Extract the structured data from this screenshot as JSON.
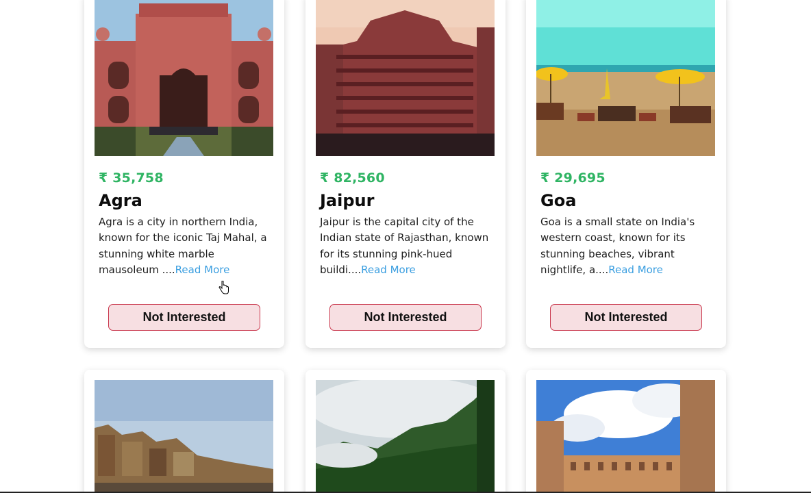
{
  "currency_symbol": "₹",
  "cards": [
    {
      "price": "₹ 35,758",
      "title": "Agra",
      "description": "Agra is a city in northern India, known for the iconic Taj Mahal, a stunning white marble mausoleum ....",
      "read_more": "Read More",
      "button": "Not Interested"
    },
    {
      "price": "₹ 82,560",
      "title": "Jaipur",
      "description": "Jaipur is the capital city of the Indian state of Rajasthan, known for its stunning pink-hued buildi....",
      "read_more": "Read More",
      "button": "Not Interested"
    },
    {
      "price": "₹ 29,695",
      "title": "Goa",
      "description": "Goa is a small state on India's western coast, known for its stunning beaches, vibrant nightlife, a....",
      "read_more": "Read More",
      "button": "Not Interested"
    }
  ],
  "colors": {
    "price": "#2fb463",
    "link": "#3a9ee0",
    "button_bg": "#f7dfe2",
    "button_border": "#c8344a"
  }
}
